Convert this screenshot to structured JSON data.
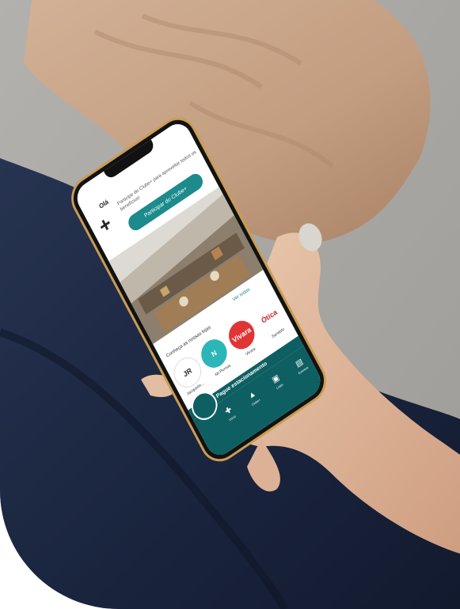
{
  "app": {
    "greeting": "Olá",
    "join_text": "Participe do Clube+ para aproveitar todos os benefícios!",
    "join_button": "Participar do Clube+",
    "see_all": "Ver todas",
    "section_title": "Conheça as nossas lojas",
    "stores": [
      "JR",
      "N",
      "Vivara",
      "Ótica"
    ],
    "store_labels": [
      "Jacquelin...",
      "Mr.Pernas",
      "Vivara",
      "Sandalo"
    ],
    "page_bar": "Pague estacionamento",
    "nav": [
      "Início",
      "Clube+",
      "Lojas",
      "Eventos"
    ]
  },
  "colors": {
    "accent": "#1d8a8c",
    "nav": "#0e5f62",
    "sweater": "#c9a58a",
    "jeans": "#1d2a45",
    "phone_gold": "#c99d55"
  }
}
